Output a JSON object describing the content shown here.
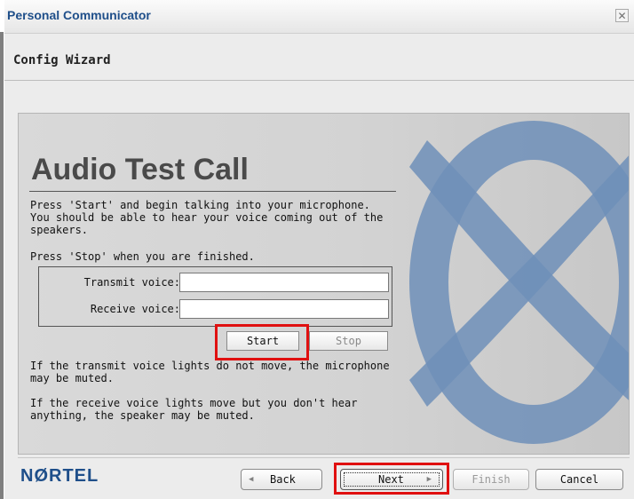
{
  "window": {
    "title": "Personal Communicator",
    "close_glyph": "✕"
  },
  "header": {
    "title": "Config Wizard"
  },
  "content": {
    "heading": "Audio Test Call",
    "intro": "Press 'Start' and begin talking into your microphone. You should be able to hear your voice coming out of the speakers.",
    "stop_hint": "Press 'Stop' when you are finished.",
    "transmit_label": "Transmit voice:",
    "receive_label": "Receive voice:",
    "start_label": "Start",
    "stop_label": "Stop",
    "mic_hint": "If the transmit voice lights do not move, the microphone may be muted.",
    "speaker_hint": "If the receive voice lights move but you don't hear anything, the speaker may be muted."
  },
  "footer": {
    "brand": "NØRTEL",
    "back_label": "Back",
    "next_label": "Next",
    "finish_label": "Finish",
    "cancel_label": "Cancel",
    "back_icon": "◀",
    "next_icon": "▶"
  },
  "colors": {
    "title_blue": "#1f4f8a",
    "highlight_red": "#e01010",
    "watermark_blue": "#6f8fb8"
  },
  "icons": {
    "brand_watermark": "nortel-globe-icon",
    "close": "close-icon"
  }
}
